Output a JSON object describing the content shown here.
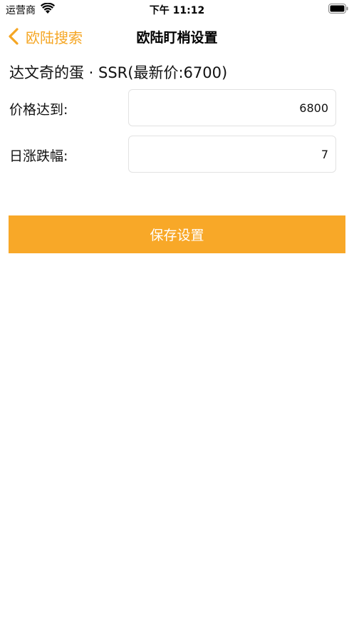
{
  "status_bar": {
    "carrier": "运营商",
    "time": "下午 11:12"
  },
  "nav": {
    "back_label": "欧陆搜索",
    "title": "欧陆盯梢设置"
  },
  "item": {
    "title": "达文奇的蛋 · SSR(最新价:6700)"
  },
  "form": {
    "price_label": "价格达到:",
    "price_value": "6800",
    "change_label": "日涨跌幅:",
    "change_value": "7"
  },
  "actions": {
    "save_label": "保存设置"
  },
  "colors": {
    "accent": "#f5a623",
    "button": "#f8a828"
  }
}
